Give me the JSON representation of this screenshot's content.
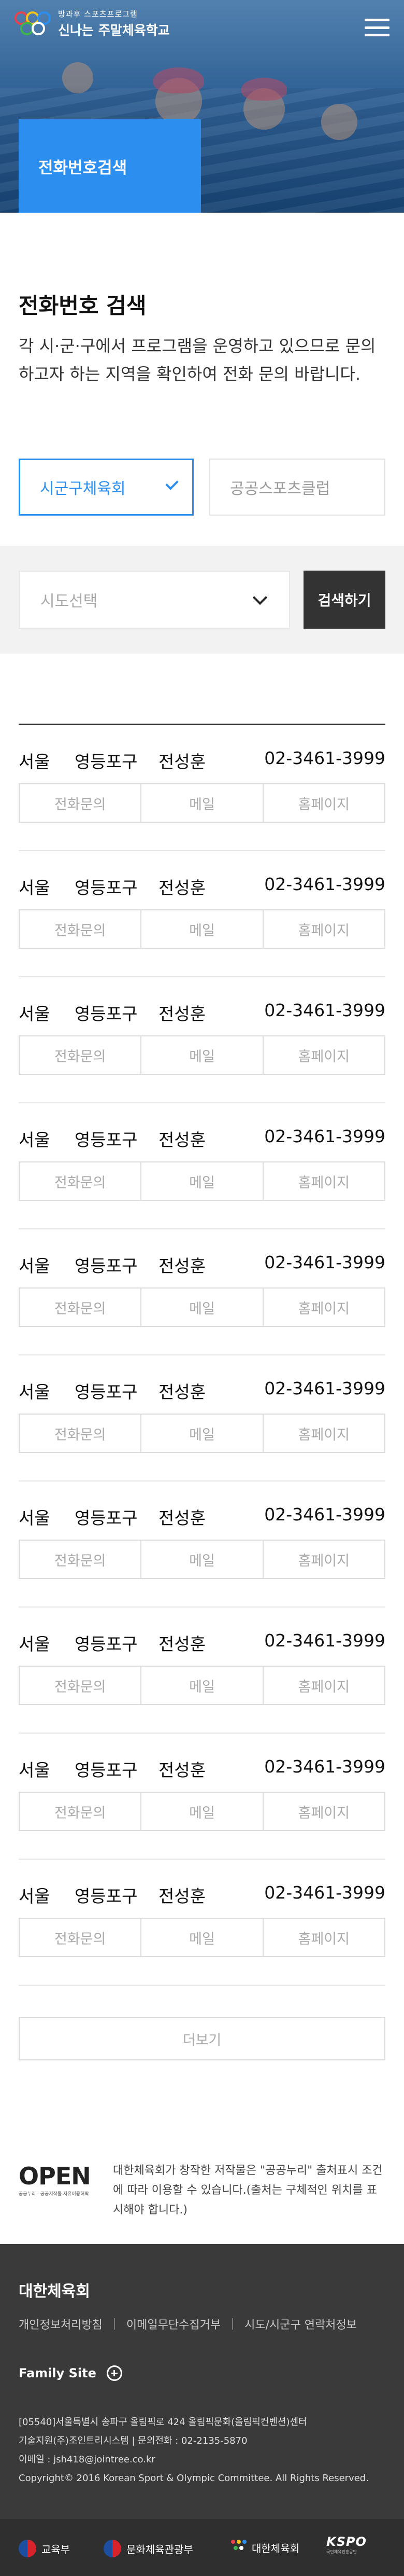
{
  "header": {
    "logo_line1": "방과후 스포츠프로그램",
    "logo_line2": "신나는 주말체육학교",
    "page_title": "전화번호검색"
  },
  "intro": {
    "title": "전화번호 검색",
    "description": "각 시·군·구에서 프로그램을 운영하고 있으므로 문의하고자 하는 지역을 확인하여 전화 문의 바랍니다."
  },
  "tabs": [
    {
      "label": "시군구체육회",
      "active": true
    },
    {
      "label": "공공스포츠클럽",
      "active": false
    }
  ],
  "search": {
    "select_value": "시도선택",
    "button_label": "검색하기"
  },
  "list": {
    "items": [
      {
        "region": "서울",
        "district": "영등포구",
        "name": "전성훈",
        "phone": "02-3461-3999"
      },
      {
        "region": "서울",
        "district": "영등포구",
        "name": "전성훈",
        "phone": "02-3461-3999"
      },
      {
        "region": "서울",
        "district": "영등포구",
        "name": "전성훈",
        "phone": "02-3461-3999"
      },
      {
        "region": "서울",
        "district": "영등포구",
        "name": "전성훈",
        "phone": "02-3461-3999"
      },
      {
        "region": "서울",
        "district": "영등포구",
        "name": "전성훈",
        "phone": "02-3461-3999"
      },
      {
        "region": "서울",
        "district": "영등포구",
        "name": "전성훈",
        "phone": "02-3461-3999"
      },
      {
        "region": "서울",
        "district": "영등포구",
        "name": "전성훈",
        "phone": "02-3461-3999"
      },
      {
        "region": "서울",
        "district": "영등포구",
        "name": "전성훈",
        "phone": "02-3461-3999"
      },
      {
        "region": "서울",
        "district": "영등포구",
        "name": "전성훈",
        "phone": "02-3461-3999"
      },
      {
        "region": "서울",
        "district": "영등포구",
        "name": "전성훈",
        "phone": "02-3461-3999"
      }
    ],
    "btn_call": "전화문의",
    "btn_mail": "메일",
    "btn_home": "홈페이지",
    "more_label": "더보기"
  },
  "notice": {
    "logo_big": "OPEN",
    "logo_small": "공공누리 · 공공저작물 자유이용허락",
    "text": "대한체육회가 창작한 저작물은 \"공공누리\" 출처표시 조건에 따라 이용할 수 있습니다.(출처는 구체적인 위치를 표시해야 합니다.)"
  },
  "footer": {
    "title": "대한체육회",
    "links": [
      "개인정보처리방침",
      "이메일무단수집거부",
      "시도/시군구 연락처정보"
    ],
    "family_site": "Family Site",
    "address_lines": [
      "[05540]서울특별시 송파구 올림픽로 424 올림픽문화(올림픽컨벤션)센터",
      "기술지원(주)조인트리시스템 | 문의전화 : 02-2135-5870",
      "이메일 : jsh418@jointree.co.kr",
      "Copyright© 2016 Korean Sport & Olympic Committee. All Rights Reserved."
    ],
    "org_logos": [
      "교육부",
      "문화체육관광부",
      "대한체육회",
      "KSPO"
    ],
    "kspo_sub": "국민체육진흥공단"
  },
  "colors": {
    "accent": "#2c8ff0",
    "dark_button": "#333333",
    "footer_bg": "#3a3a3a"
  }
}
